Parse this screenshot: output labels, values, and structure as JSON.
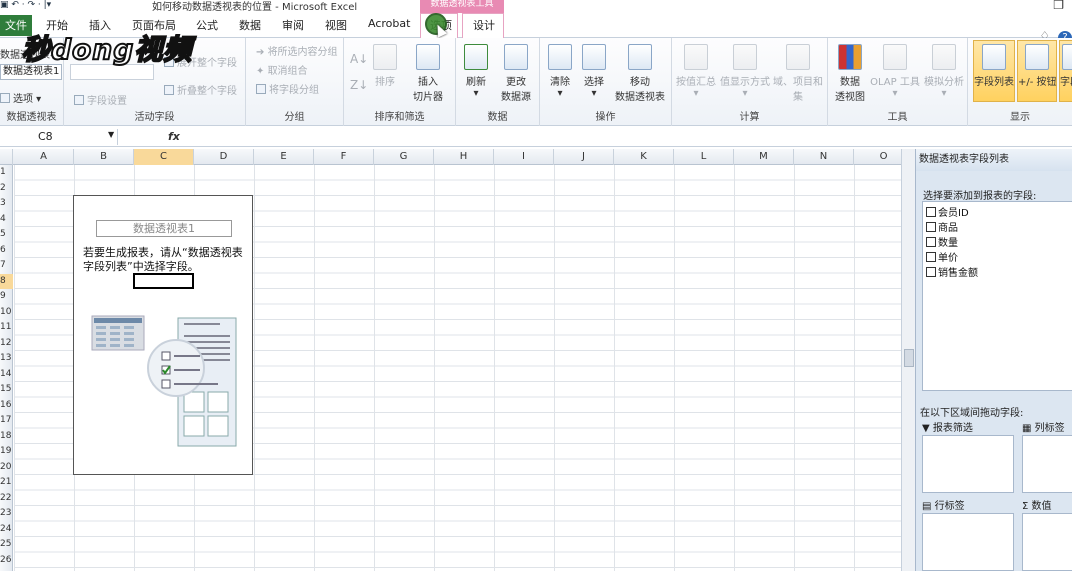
{
  "window": {
    "title": "如何移动数据透视表的位置 - Microsoft Excel",
    "context_tool_header": "数据透视表工具",
    "quick_access": "▣ ↶ · ↷ · |▾",
    "restore_icon": "❐",
    "ribbon_min_icon": "♢",
    "help_icon": "?"
  },
  "tabs": {
    "file": "文件",
    "items": [
      "开始",
      "插入",
      "页面布局",
      "公式",
      "数据",
      "审阅",
      "视图",
      "Acrobat"
    ],
    "active": "选项",
    "design": "设计"
  },
  "watermark": "秒dong视频",
  "ribbon": {
    "pivot_group": {
      "label": "数据透视表",
      "name_label": "数据透视表名",
      "name_value": "数据透视表1",
      "options": "选项"
    },
    "active_field_group": {
      "label": "活动字段",
      "field_settings": "字段设置",
      "expand": "展开整个字段",
      "collapse": "折叠整个字段"
    },
    "group_group": {
      "label": "分组",
      "group_selection": "将所选内容分组",
      "ungroup": "取消组合",
      "group_field": "将字段分组"
    },
    "sort_group": {
      "label": "排序和筛选",
      "sort": "排序",
      "slicer_line1": "插入",
      "slicer_line2": "切片器"
    },
    "data_group": {
      "label": "数据",
      "refresh": "刷新",
      "change_source_line1": "更改",
      "change_source_line2": "数据源"
    },
    "actions_group": {
      "label": "操作",
      "clear": "清除",
      "select": "选择",
      "move_line1": "移动",
      "move_line2": "数据透视表"
    },
    "calc_group": {
      "label": "计算",
      "summarize": "按值汇总",
      "show_values": "值显示方式",
      "fields_items_line1": "域、项目和",
      "fields_items_line2": "集"
    },
    "tools_group": {
      "label": "工具",
      "pivot_chart_line1": "数据",
      "pivot_chart_line2": "透视图",
      "olap": "OLAP 工具",
      "what_if": "模拟分析"
    },
    "show_group": {
      "label": "显示",
      "field_list": "字段列表",
      "buttons": "+/- 按钮",
      "headers": "字段标题"
    }
  },
  "formula_bar": {
    "name_box": "C8",
    "fx": "fx",
    "formula": ""
  },
  "grid": {
    "columns": [
      "A",
      "B",
      "C",
      "D",
      "E",
      "F",
      "G",
      "H",
      "I",
      "J",
      "K",
      "L",
      "M",
      "N",
      "O"
    ],
    "rows": [
      "1",
      "2",
      "3",
      "4",
      "5",
      "6",
      "7",
      "8",
      "9",
      "10",
      "11",
      "12",
      "13",
      "14",
      "15",
      "16",
      "17",
      "18",
      "19",
      "20",
      "21",
      "22",
      "23",
      "24",
      "25",
      "26"
    ],
    "selected_column": "C",
    "selected_row": "8"
  },
  "pivot_placeholder": {
    "title": "数据透视表1",
    "instruction": "若要生成报表，请从“数据透视表字段列表”中选择字段。"
  },
  "field_list_pane": {
    "title": "数据透视表字段列表",
    "choose_prompt": "选择要添加到报表的字段:",
    "fields": [
      "会员ID",
      "商品",
      "数量",
      "单价",
      "销售金额"
    ],
    "drag_prompt": "在以下区域间拖动字段:",
    "areas": {
      "report_filter": "报表筛选",
      "column_labels": "列标签",
      "row_labels": "行标签",
      "values": "数值"
    }
  }
}
